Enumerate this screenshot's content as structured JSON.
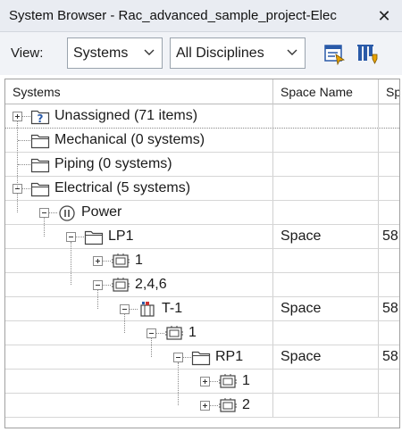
{
  "window": {
    "title": "System Browser - Rac_advanced_sample_project-Elec",
    "close_glyph": "✕"
  },
  "toolbar": {
    "view_label": "View:",
    "view_select": "Systems",
    "discipline_select": "All Disciplines",
    "icons": [
      "column-settings-icon",
      "properties-icon"
    ]
  },
  "grid": {
    "columns": [
      "Systems",
      "Space Name",
      "Sp"
    ],
    "rows": [
      {
        "label": "Unassigned (71 items)",
        "space": "",
        "sp": "",
        "icon": "unknown-folder-icon",
        "expander": "plus"
      },
      {
        "label": "Mechanical (0 systems)",
        "space": "",
        "sp": "",
        "icon": "folder-icon",
        "expander": "none"
      },
      {
        "label": "Piping (0 systems)",
        "space": "",
        "sp": "",
        "icon": "folder-icon",
        "expander": "none"
      },
      {
        "label": "Electrical (5 systems)",
        "space": "",
        "sp": "",
        "icon": "folder-icon",
        "expander": "minus"
      },
      {
        "label": "Power",
        "space": "",
        "sp": "",
        "icon": "power-icon",
        "expander": "minus"
      },
      {
        "label": "LP1",
        "space": "Space",
        "sp": "58",
        "icon": "folder-icon",
        "expander": "minus"
      },
      {
        "label": "1",
        "space": "",
        "sp": "",
        "icon": "circuit-icon",
        "expander": "plus"
      },
      {
        "label": "2,4,6",
        "space": "",
        "sp": "",
        "icon": "circuit-icon",
        "expander": "minus"
      },
      {
        "label": "T-1",
        "space": "Space",
        "sp": "58",
        "icon": "transformer-icon",
        "expander": "minus"
      },
      {
        "label": "1",
        "space": "",
        "sp": "",
        "icon": "circuit-icon",
        "expander": "minus"
      },
      {
        "label": "RP1",
        "space": "Space",
        "sp": "58",
        "icon": "folder-icon",
        "expander": "minus"
      },
      {
        "label": "1",
        "space": "",
        "sp": "",
        "icon": "circuit-icon",
        "expander": "plus"
      },
      {
        "label": "2",
        "space": "",
        "sp": "",
        "icon": "circuit-icon",
        "expander": "plus"
      }
    ]
  }
}
